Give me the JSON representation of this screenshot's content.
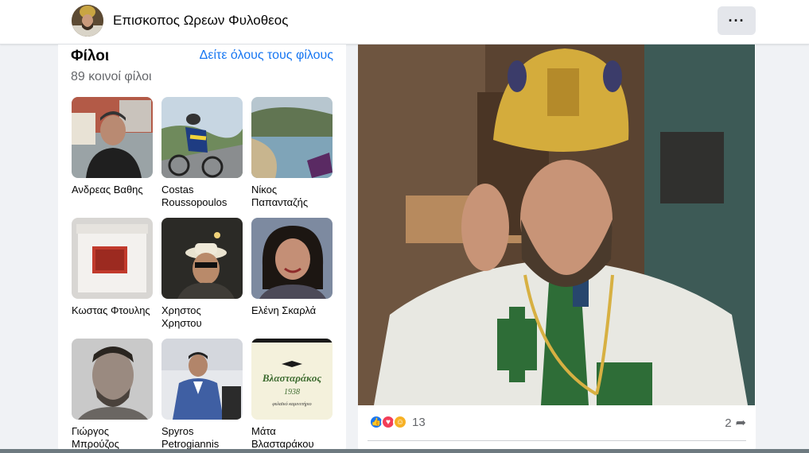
{
  "header": {
    "page_name": "Επισκοπος Ωρεων Φυλοθεος",
    "more_label": "···"
  },
  "friends": {
    "title": "Φίλοι",
    "see_all": "Δείτε όλους τους φίλους",
    "mutual": "89 κοινοί φίλοι",
    "items": [
      {
        "name": "Ανδρεας Βαθης"
      },
      {
        "name": "Costas Roussopoulos"
      },
      {
        "name": "Νίκος Παπανταζής"
      },
      {
        "name": "Κωστας Φτουλης"
      },
      {
        "name": "Χρηστος Χρηστου"
      },
      {
        "name": "Ελένη Σκαρλά"
      },
      {
        "name": "Γιώργος Μπρούζος"
      },
      {
        "name": "Spyros Petrogiannis"
      },
      {
        "name": "Μάτα Βλασταράκου"
      }
    ],
    "logo_text": {
      "brand": "Βλασταράκος",
      "year": "1938",
      "tagline": "φυλαϊκό καμινετήριο"
    }
  },
  "post": {
    "reaction_count": "13",
    "share_count": "2",
    "reaction_icons": [
      "like-icon",
      "love-icon",
      "care-icon"
    ]
  },
  "colors": {
    "accent": "#1877f2",
    "secondary_text": "#65676b",
    "background": "#f0f2f5"
  }
}
